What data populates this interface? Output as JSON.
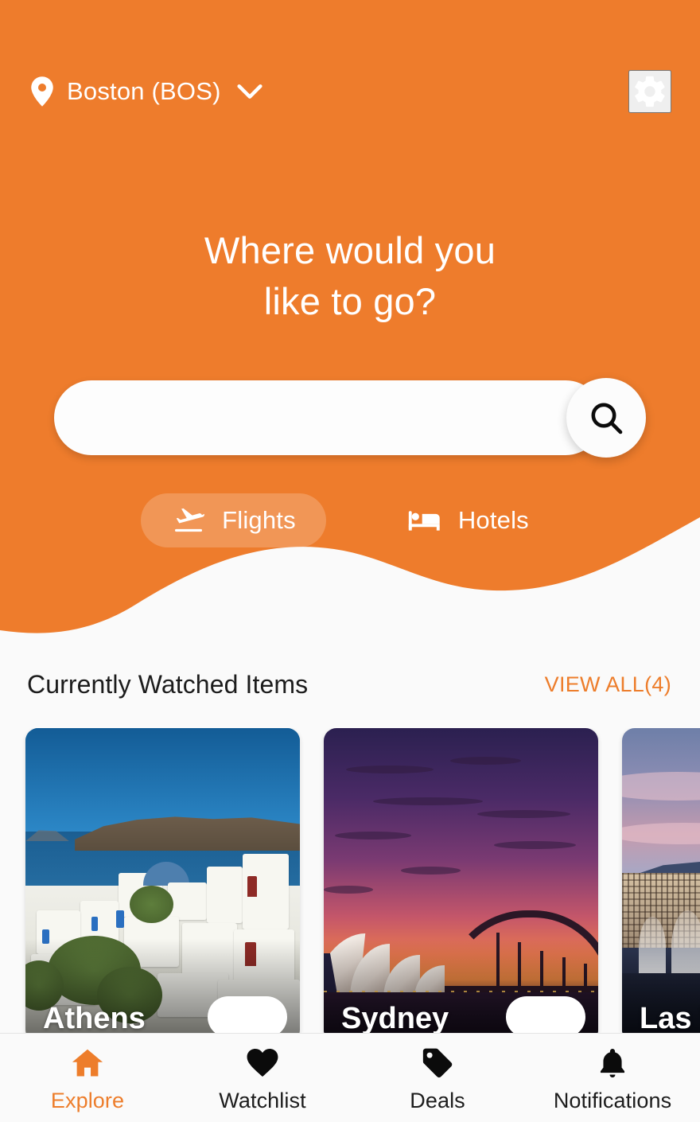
{
  "colors": {
    "brand_orange": "#ED7D2B",
    "header_orange": "#EE7C2C",
    "page_background": "#FAFAFA",
    "text_dark": "#1C1C1C",
    "white": "#FFFFFF"
  },
  "topbar": {
    "location_label": "Boston (BOS)",
    "pin_icon": "location-pin-icon",
    "chevron_icon": "chevron-down-icon",
    "settings_icon": "gear-icon"
  },
  "hero": {
    "headline_line1": "Where would you",
    "headline_line2": "like to go?"
  },
  "search": {
    "value": "",
    "placeholder": "",
    "button_icon": "search-icon"
  },
  "modes": [
    {
      "label": "Flights",
      "icon": "flight-takeoff-icon",
      "active": true
    },
    {
      "label": "Hotels",
      "icon": "bed-icon",
      "active": false
    }
  ],
  "watched_section": {
    "title": "Currently Watched Items",
    "view_all_label": "VIEW ALL(4)",
    "count": 4
  },
  "cards": [
    {
      "name": "Athens",
      "chip": ""
    },
    {
      "name": "Sydney",
      "chip": ""
    },
    {
      "name": "Las Vegas",
      "chip": ""
    }
  ],
  "bottom_nav": [
    {
      "label": "Explore",
      "icon": "home-icon",
      "active": true
    },
    {
      "label": "Watchlist",
      "icon": "heart-icon",
      "active": false
    },
    {
      "label": "Deals",
      "icon": "tag-icon",
      "active": false
    },
    {
      "label": "Notifications",
      "icon": "bell-icon",
      "active": false
    }
  ]
}
